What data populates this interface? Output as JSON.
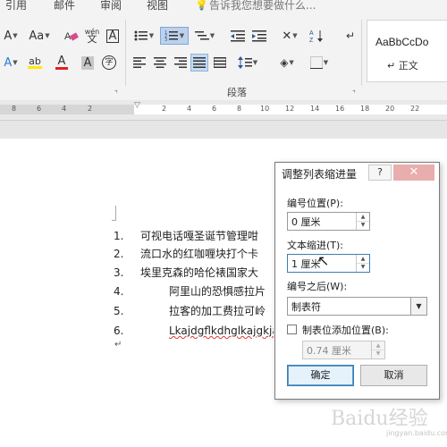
{
  "ribbon": {
    "tabs": [
      "引用",
      "邮件",
      "审阅",
      "视图"
    ],
    "tell_me": "告诉我您想要做什么...",
    "row1_buttons": [
      "A",
      "Aa",
      "清除格式",
      "wén",
      "A",
      "项目符号",
      "编号",
      "多级列表",
      "减少缩进",
      "增加缩进",
      "中文版式",
      "排序",
      "显示/隐藏编辑标记"
    ],
    "row2_buttons": [
      "A",
      "ab",
      "A",
      "A",
      "字",
      "左对齐",
      "居中",
      "右对齐",
      "两端对齐",
      "分散对齐",
      "行距",
      "底纹",
      "边框"
    ],
    "paragraph_group_label": "段落",
    "styles": {
      "sample": "AaBbCcDo",
      "name": "↵ 正文"
    }
  },
  "ruler": {
    "numbers": [
      "8",
      "6",
      "4",
      "2",
      "2",
      "4",
      "6",
      "8",
      "10",
      "12",
      "14",
      "16",
      "18",
      "20",
      "22"
    ]
  },
  "document": {
    "items": [
      {
        "num": "1.",
        "text": "可视电话嘎圣诞节管理咁"
      },
      {
        "num": "2.",
        "text": "流口水的红咖喱块打个卡"
      },
      {
        "num": "3.",
        "text": "埃里克森的哈伦裱国家大"
      },
      {
        "num": "4.",
        "text": "阿里山的恐惧感拉片"
      },
      {
        "num": "5.",
        "text": "拉客的加工费拉可岭"
      },
      {
        "num": "6.",
        "text": "Lkajdgflkdhglkajgkjå"
      }
    ],
    "paragraph_mark": "↵"
  },
  "dialog": {
    "title": "调整列表缩进量",
    "help": "?",
    "close": "✕",
    "number_position_label": "编号位置(P):",
    "number_position_value": "0 厘米",
    "text_indent_label": "文本缩进(T):",
    "text_indent_value": "1 厘米",
    "follow_number_label": "编号之后(W):",
    "follow_number_value": "制表符",
    "tab_stop_label": "制表位添加位置(B):",
    "tab_stop_value": "0.74 厘米",
    "tab_stop_checked": false,
    "ok": "确定",
    "cancel": "取消"
  },
  "watermark": {
    "logo": "Baidu经验",
    "url": "jingyan.baidu.com"
  }
}
